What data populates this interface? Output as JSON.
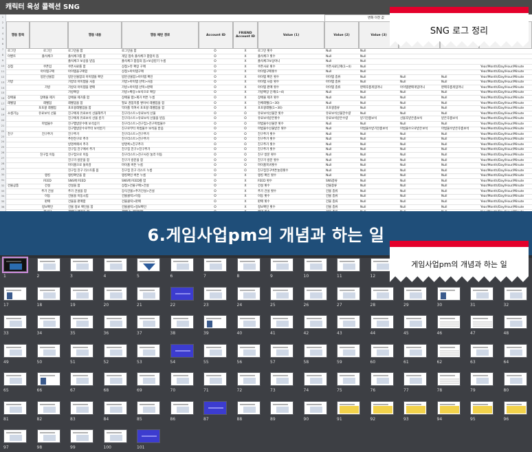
{
  "spreadsheet": {
    "title": "캐릭터 육성 콜렉션 SNG",
    "change_header": "변화 이전 값",
    "headers": [
      "행동 항목",
      "",
      "행동 내용",
      "행동 패턴 경로",
      "Account ID",
      "FRIEND Account ID",
      "Value (1)",
      "Value (2)",
      "Value (3)",
      "",
      "",
      ""
    ],
    "rows": [
      [
        "로그인",
        "로그인",
        "로그인을 함",
        "로그인을 함",
        "O",
        "X",
        "로그인 횟수",
        "Null",
        "Null",
        "",
        "",
        ""
      ],
      [
        "이벤트",
        "출석체크",
        "출석체크를 함",
        "게임 접속 출석체크 팝업이 뜸",
        "O",
        "X",
        "출석체크 횟수",
        "Null",
        "Null",
        "",
        "",
        ""
      ],
      [
        "",
        "",
        "출석체크 보상을 받음",
        "출석체크 팝업의 뜸>보상받기 누름",
        "O",
        "X",
        "출석체크보상아니",
        "Null",
        "Null",
        "",
        "",
        ""
      ],
      [
        "상점",
        "쿠폰입",
        "쿠폰사료를 함",
        "상점>뷰 확장 구매",
        "O",
        "X",
        "쿠폰사료 횟수",
        "쿠폰사료단계(1~4)",
        "Null",
        "",
        "",
        "Year/Month/Day/Hour/Minute"
      ],
      [
        "",
        "아이템구매",
        "아이템을구매함",
        "상점>아이템구매",
        "O",
        "X",
        "아이템구매횟수",
        "Null",
        "Null",
        "",
        "",
        "Year/Month/Day/Hour/Minute"
      ],
      [
        "",
        "방문선물함",
        "방문선물함의 아이템을 확인",
        "방문선물함>아이템 확인",
        "O",
        "X",
        "아이템 확인 횟수",
        "아이템 종류",
        "Null",
        "Null",
        "Null",
        "Year/Month/Day/Hour/Minute"
      ],
      [
        "가방",
        "",
        "가방의 아이템을 사용",
        "가방>아이템 선택>사용",
        "O",
        "X",
        "아이템 사용 횟수",
        "아이템 종류",
        "Null",
        "Null",
        "Null",
        "Year/Month/Day/Hour/Minute"
      ],
      [
        "",
        "가방",
        "가방의 아이템을 판매",
        "가방>아이템 선택>판매",
        "O",
        "X",
        "아이템 판매 횟수",
        "아이템 종류",
        "판매후총게임머니",
        "아이템판매게임머니",
        "판매후총게임머니",
        "Year/Month/Day/Hour/Minute"
      ],
      [
        "",
        "",
        "가방확장",
        "가방>확장>보석으로 확장",
        "O",
        "X",
        "가방확장 단계(1~4)",
        "Null",
        "Null",
        "Null",
        "Null",
        "Year/Month/Day/Hour/Minute"
      ],
      [
        "장애물",
        "장애물 제거",
        "장애물 제거를 함",
        "장애물 탭>제거 버튼 누름",
        "O",
        "X",
        "장애물 제거 횟수",
        "Null",
        "Null",
        "Null",
        "Null",
        "Year/Month/Day/Hour/Minute"
      ],
      [
        "레벨업",
        "레벨업",
        "레벨업을 함",
        "필요 경험치를 쌓아서 레벨업을 함",
        "O",
        "X",
        "전체레벨(1~30)",
        "Null",
        "Null",
        "Null",
        "Null",
        "Year/Month/Day/Hour/Minute"
      ],
      [
        "",
        "포포팡 레벨업",
        "포포팡레벨업을 함",
        "먹이를 먹여서 포포팡 레벨업을 함",
        "O",
        "X",
        "포포팡레벨(1~30)",
        "포포팡종류",
        "Null",
        "Null",
        "Null",
        "Year/Month/Day/Hour/Minute"
      ],
      [
        "소셜기능",
        "유료보석 선물",
        "친구에게 유료보석 선물해주기",
        "친구리스트>유료보석 선물",
        "O",
        "O",
        "유료보석선물한 횟수",
        "유료보석선물한수량",
        "Null",
        "Null",
        "Null",
        "Year/Month/Day/Hour/Minute"
      ],
      [
        "",
        "",
        "친구에게 유료보석 선물 받기",
        "친구리스트>유료보석 선물을 받음",
        "O",
        "O",
        "유료보석받은횟수",
        "유료보석받은수량",
        "받기전총보석",
        "선물후받은총보석",
        "받은후총보석",
        "Year/Month/Day/Hour/Minute"
      ],
      [
        "",
        "마법물수",
        "친구맵방문수에 보석상기",
        "친구리스트>친구집>친구마법물수",
        "O",
        "O",
        "마법물수선물한 횟수",
        "Null",
        "Null",
        "Null",
        "Null",
        "Year/Month/Day/Hour/Minute"
      ],
      [
        "",
        "",
        "친구맵방문수로부터 보석받기",
        "친구로부터 마법물수 보석을 받음",
        "O",
        "O",
        "마법물수선물받은 횟수",
        "Null",
        "마법물수받기전총보석",
        "마법물수으로받은보석",
        "마법물수받은후총보석",
        "Year/Month/Day/Hour/Minute"
      ],
      [
        "친구",
        "친구추가",
        "친구추가",
        "친구리스트>친구추가",
        "O",
        "O",
        "친구추가 횟수",
        "Null",
        "Null",
        "Null",
        "Null",
        "Year/Month/Day/Hour/Minute"
      ],
      [
        "",
        "",
        "추천친구로 추가",
        "친구리스트>친구추가",
        "O",
        "O",
        "친구추가 횟수",
        "Null",
        "Null",
        "Null",
        "Null",
        "Year/Month/Day/Hour/Minute"
      ],
      [
        "",
        "",
        "방명록에서 추가",
        "방명록>친구추가",
        "O",
        "O",
        "친구추가 횟수",
        "Null",
        "Null",
        "Null",
        "Null",
        "Year/Month/Day/Hour/Minute"
      ],
      [
        "",
        "",
        "친구집 친구에서 추가",
        "친구집 친구>친구추가",
        "O",
        "O",
        "친구추가 횟수",
        "Null",
        "Null",
        "Null",
        "Null",
        "Year/Month/Day/Hour/Minute"
      ],
      [
        "",
        "친구집 이동",
        "친구집으로 이동",
        "친구리스트>친구사진 눌러 이동",
        "O",
        "O",
        "친구 방문 횟수",
        "Null",
        "Null",
        "Null",
        "Null",
        "Year/Month/Day/Hour/Minute"
      ],
      [
        "",
        "",
        "친구가 방문을 함",
        "친구가 방문을 함",
        "O",
        "O",
        "친구가 방문 횟수",
        "Null",
        "Null",
        "Null",
        "Null",
        "Year/Month/Day/Hour/Minute"
      ],
      [
        "",
        "",
        "마이홈으로 돌아감",
        "마이홈 버튼 누름",
        "O",
        "O",
        "마이홈복귀횟수",
        "Null",
        "Null",
        "Null",
        "Null",
        "Year/Month/Day/Hour/Minute"
      ],
      [
        "",
        "",
        "친구집 친구 리스트를 봄",
        "친구집 친구 리스트 누름",
        "O",
        "O",
        "친구집친구버튼눌렀횟수",
        "Null",
        "Null",
        "Null",
        "Null",
        "Year/Month/Day/Hour/Minute"
      ],
      [
        "",
        "랭킹",
        "랭킹확인을 함",
        "랭킹확인 버튼 누름",
        "O",
        "X",
        "랭킹 확인 횟수",
        "Null",
        "Null",
        "Null",
        "Null",
        "Year/Month/Day/Hour/Minute"
      ],
      [
        "",
        "FEED",
        "SNS에 FEED",
        "SNS에 FEED를 함",
        "O",
        "X",
        "FEED 횟수",
        "SNS종류",
        "Null",
        "Null",
        "Null",
        "Year/Month/Day/Hour/Minute"
      ],
      [
        "건물공통",
        "건설",
        "건설을 함",
        "상점>건물구매>건설",
        "O",
        "X",
        "건설 횟수",
        "건물종류",
        "Null",
        "Null",
        "Null",
        "Year/Month/Day/Hour/Minute"
      ],
      [
        "",
        "추가 건설",
        "추가 건설을 함",
        "장식건물>추가건설>건설",
        "O",
        "X",
        "추가 건설 횟수",
        "건물 종류",
        "Null",
        "Null",
        "Null",
        "Year/Month/Day/Hour/Minute"
      ],
      [
        "",
        "이동",
        "건물을 이동시킴",
        "건물클릭>이동",
        "O",
        "X",
        "이동 횟수",
        "건물 종류",
        "Null",
        "Null",
        "Null",
        "Year/Month/Day/Hour/Minute"
      ],
      [
        "",
        "판매",
        "건물을 판매함",
        "건물클릭>판매",
        "O",
        "X",
        "판매 횟수",
        "건물 종류",
        "Null",
        "Null",
        "Null",
        "Year/Month/Day/Hour/Minute"
      ],
      [
        "",
        "정보확인",
        "건물 정보 확인을 함",
        "건물클릭>정보확인",
        "O",
        "X",
        "정보확인 횟수",
        "건물 종류",
        "Null",
        "Null",
        "Null",
        "Year/Month/Day/Hour/Minute"
      ],
      [
        "",
        "재사다",
        "재배다 예약을 함",
        "재배다>예약버튼",
        "O",
        "X",
        "예약 횟수",
        "건물 종류",
        "Null",
        "Null",
        "Null",
        "Year/Month/Day/Hour/Minute"
      ]
    ]
  },
  "callout_top": "SNG 로그 정리",
  "banner": "6.게임사업pm의 개념과 하는 일",
  "callout_bottom": "게임사업pm의 개념과 하는 일",
  "slide_numbers": [
    "1",
    "2",
    "3",
    "4",
    "5",
    "6",
    "7",
    "8",
    "9",
    "10",
    "11",
    "12",
    "13",
    "14",
    "15",
    "16",
    "17",
    "18",
    "19",
    "20",
    "21",
    "22",
    "23",
    "24",
    "25",
    "26",
    "27",
    "28",
    "29",
    "30",
    "31",
    "32",
    "33",
    "34",
    "35",
    "36",
    "37",
    "38",
    "39",
    "40",
    "41",
    "42",
    "43",
    "44",
    "45",
    "46",
    "47",
    "48",
    "49",
    "50",
    "51",
    "52",
    "53",
    "54",
    "55",
    "56",
    "57",
    "58",
    "59",
    "60",
    "61",
    "62",
    "63",
    "64",
    "65",
    "66",
    "67",
    "68",
    "69",
    "70",
    "71",
    "72",
    "73",
    "74",
    "75",
    "76",
    "77",
    "78",
    "79",
    "80",
    "81",
    "82",
    "83",
    "84",
    "85",
    "86",
    "87",
    "88",
    "89",
    "90",
    "91",
    "92",
    "93",
    "94",
    "95",
    "96",
    "97",
    "98",
    "99",
    "100",
    "101"
  ],
  "slide_styles": [
    "dark",
    "",
    "",
    "",
    "tri",
    "",
    "",
    "",
    "",
    "",
    "",
    "",
    "",
    "",
    "",
    "",
    "fig",
    "",
    "",
    "",
    "",
    "purple",
    "",
    "",
    "",
    "",
    "",
    "",
    "",
    "fig",
    "",
    "",
    "",
    "",
    "",
    "",
    "",
    "",
    "fig",
    "",
    "",
    "",
    "",
    "",
    "",
    "tbl",
    "tbl",
    "",
    "",
    "",
    "",
    "",
    "",
    "purple",
    "",
    "",
    "",
    "",
    "",
    "",
    "",
    "tbl",
    "",
    "",
    "",
    "fig",
    "",
    "",
    "",
    "",
    "",
    "",
    "",
    "",
    "",
    "",
    "",
    "tbl",
    "",
    "",
    "",
    "",
    "",
    "",
    "",
    "",
    "purple",
    "",
    "",
    "",
    "yellow",
    "yellow",
    "yellow",
    "yellow",
    "yellow",
    "yellow",
    "",
    "",
    "",
    "",
    "purple"
  ],
  "accent_colors": {
    "banner": "#1f4e79",
    "callout_bar": "#e4002b",
    "selected_slide": "#c98ad6",
    "sorter_bg": "#3d3f44"
  }
}
